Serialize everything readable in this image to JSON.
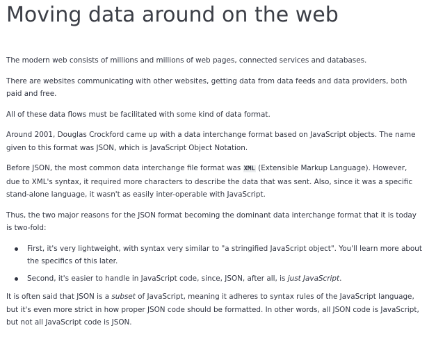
{
  "title": "Moving data around on the web",
  "paragraphs": {
    "p1": "The modern web consists of millions and millions of web pages, connected services and databases.",
    "p2": "There are websites communicating with other websites, getting data from data feeds and data providers, both paid and free.",
    "p3": "All of these data flows must be facilitated with some kind of data format.",
    "p4": "Around 2001, Douglas Crockford came up with a data interchange format based on JavaScript objects. The name given to this format was JSON, which is JavaScript Object Notation.",
    "p5_before": "Before JSON, the most common data interchange file format was ",
    "p5_code": "XML",
    "p5_after": " (Extensible Markup Language). However, due to XML's syntax, it required more characters to describe the data that was sent. Also, since it was a specific stand-alone language, it wasn't as easily inter-operable with JavaScript.",
    "p6": "Thus, the two major reasons for the JSON format becoming the dominant data interchange format that it is today is two-fold:",
    "p7_before": "It is often said that JSON is a ",
    "p7_em": "subset",
    "p7_after": " of JavaScript, meaning it adheres to syntax rules of the JavaScript language, but it's even more strict in how proper JSON code should be formatted. In other words, all JSON code is JavaScript, but not all JavaScript code is JSON."
  },
  "list": {
    "item1": "First, it's very lightweight, with syntax very similar to \"a stringified JavaScript object\". You'll learn more about the specifics of this later.",
    "item2_before": "Second, it's easier to handle in JavaScript code, since, JSON, after all, is ",
    "item2_em": "just JavaScript",
    "item2_after": "."
  }
}
